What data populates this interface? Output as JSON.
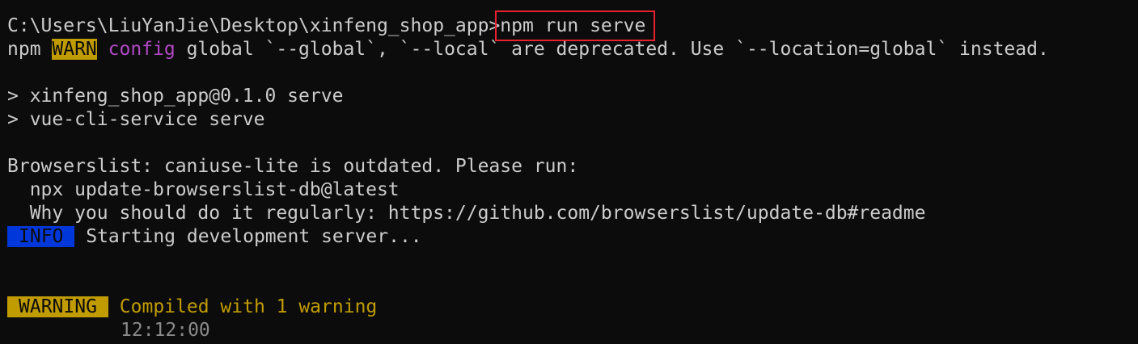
{
  "prompt": {
    "path": "C:\\Users\\LiuYanJie\\Desktop\\xinfeng_shop_app",
    "gt": ">",
    "command": "npm run serve"
  },
  "npm_warn": {
    "prefix": "npm ",
    "badge": "WARN",
    "category": "config",
    "message": " global `--global`, `--local` are deprecated. Use `--location=global` instead."
  },
  "script_lines": [
    "> xinfeng_shop_app@0.1.0 serve",
    "> vue-cli-service serve"
  ],
  "browserslist": {
    "header": "Browserslist: caniuse-lite is outdated. Please run:",
    "command": "  npx update-browserslist-db@latest",
    "why": "  Why you should do it regularly: https://github.com/browserslist/update-db#readme"
  },
  "info": {
    "badge": "INFO",
    "message": " Starting development server..."
  },
  "compile": {
    "badge": "WARNING",
    "message": " Compiled with 1 warning",
    "time": "12:12:00"
  },
  "colors": {
    "background": "#0c0c0c",
    "foreground": "#cccccc",
    "warn_yellow": "#c19c00",
    "info_blue": "#0037da",
    "config_purple": "#b148c6",
    "highlight_box_red": "#e8212e"
  }
}
